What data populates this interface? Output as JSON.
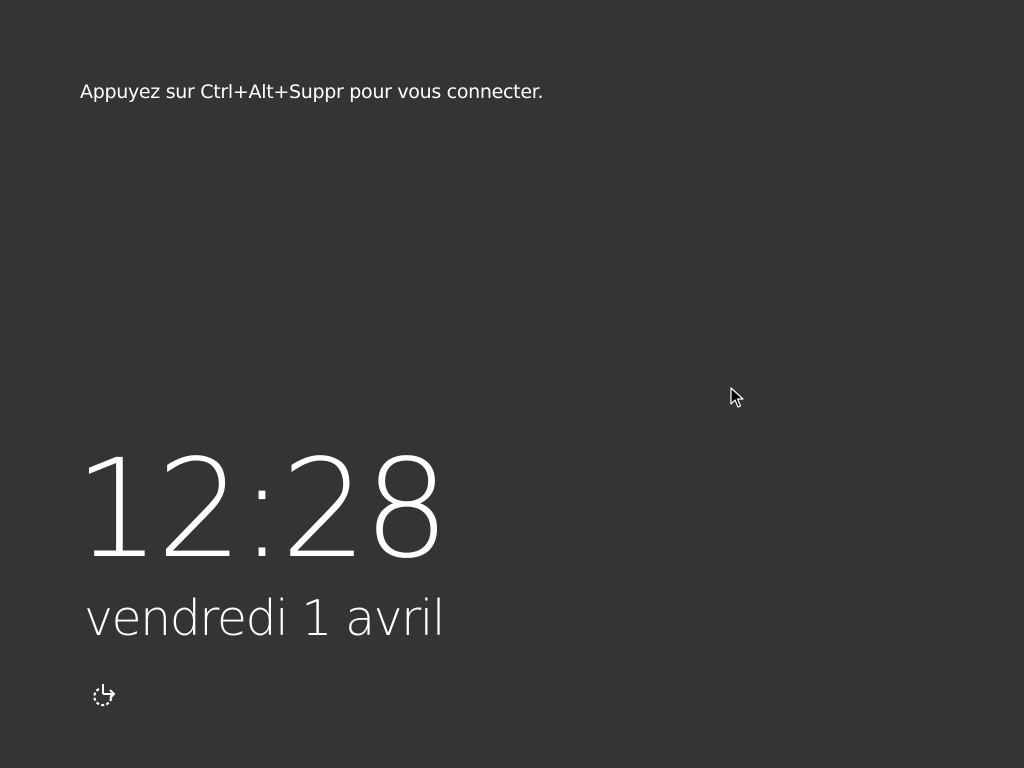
{
  "lock_screen": {
    "prompt": "Appuyez sur Ctrl+Alt+Suppr pour vous connecter.",
    "time": "12:28",
    "date": "vendredi 1 avril",
    "ease_of_access_icon": "ease-of-access-icon",
    "background_color": "#343434",
    "text_color": "#ffffff"
  }
}
